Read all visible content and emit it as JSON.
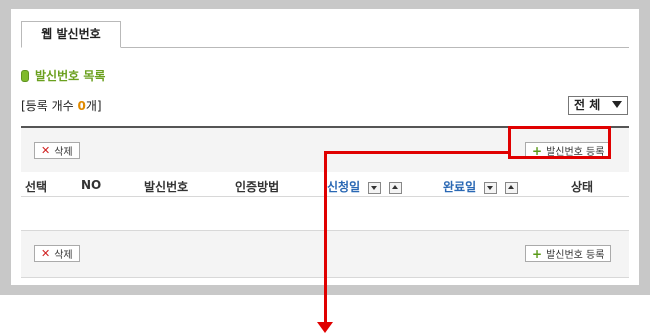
{
  "tab": {
    "label": "웹 발신번호"
  },
  "section": {
    "title": "발신번호 목록"
  },
  "count": {
    "prefix": "[등록 개수 ",
    "value": "0",
    "suffix": "개]"
  },
  "filter": {
    "selected": "전 체"
  },
  "buttons": {
    "delete": "삭제",
    "register": "발신번호 등록"
  },
  "table": {
    "headers": [
      "선택",
      "NO",
      "발신번호",
      "인증방법",
      "신청일",
      "완료일",
      "상태"
    ]
  },
  "colors": {
    "accent_green": "#6aa01e",
    "highlight_red": "#e00000",
    "link_blue": "#2a68b4",
    "count_orange": "#e08a00"
  }
}
